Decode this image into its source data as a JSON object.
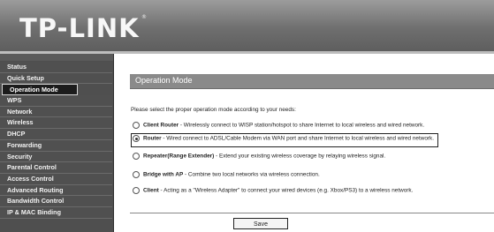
{
  "brand": {
    "logo_text": "TP-LINK",
    "trademark": "®"
  },
  "sidebar": {
    "items": [
      {
        "label": "Status"
      },
      {
        "label": "Quick Setup"
      },
      {
        "label": "Operation Mode",
        "active": true
      },
      {
        "label": "WPS"
      },
      {
        "label": "Network"
      },
      {
        "label": "Wireless"
      },
      {
        "label": "DHCP"
      },
      {
        "label": "Forwarding"
      },
      {
        "label": "Security"
      },
      {
        "label": "Parental Control"
      },
      {
        "label": "Access Control"
      },
      {
        "label": "Advanced Routing"
      },
      {
        "label": "Bandwidth Control"
      },
      {
        "label": "IP & MAC Binding"
      }
    ]
  },
  "main": {
    "title": "Operation Mode",
    "intro": "Please select the proper operation mode according to your needs:",
    "options": [
      {
        "name": "Client Router",
        "desc": " - Wirelessly connect to WISP station/hotspot to share Internet to local wireless and wired network.",
        "selected": false
      },
      {
        "name": "Router",
        "desc": " - Wired connect to ADSL/Cable Modem via WAN port and share Internet to local wireless and wired network.",
        "selected": true
      },
      {
        "name": "Repeater(Range Extender)",
        "desc": " - Extend your existing wireless coverage by relaying wireless signal.",
        "selected": false
      },
      {
        "name": "Bridge with AP",
        "desc": " - Combine two local networks via wireless connection.",
        "selected": false
      },
      {
        "name": "Client",
        "desc": " - Acting as a \"Wireless Adapter\" to connect your wired devices (e.g. Xbox/PS3) to a wireless network.",
        "selected": false
      }
    ],
    "save_label": "Save"
  },
  "colors": {
    "banner": "#7a7a7a",
    "sidebar_bg": "#4f4f4f",
    "title_bar": "#8a8a8a"
  }
}
